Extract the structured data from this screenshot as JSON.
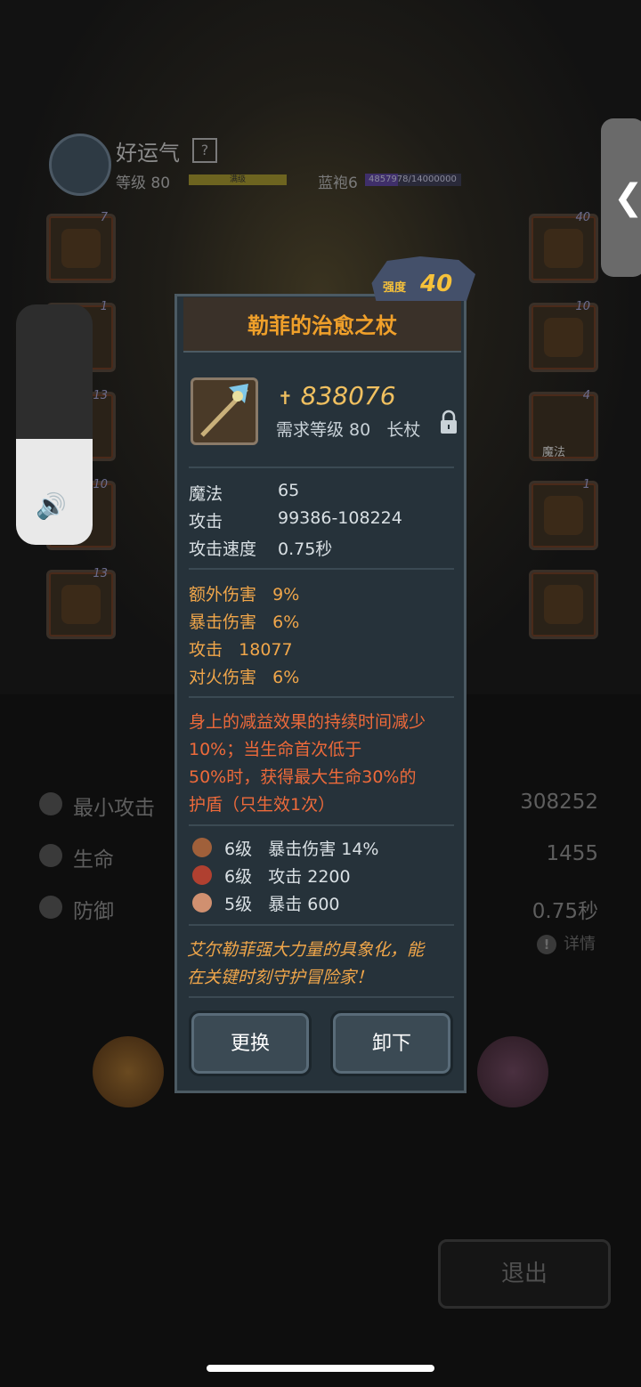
{
  "hero": {
    "name": "好运气",
    "help": "?",
    "level": "等级 80",
    "xp_label": "满级",
    "gem_label": "蓝袍6",
    "gem_progress": "4857978/14000000",
    "gem_fraction": 0.347
  },
  "slots_left": [
    {
      "num": "7"
    },
    {
      "num": "1"
    },
    {
      "num": "13"
    },
    {
      "num": "10"
    },
    {
      "num": "13"
    }
  ],
  "slots_right": [
    {
      "num": "40"
    },
    {
      "num": "10"
    },
    {
      "num": "4",
      "tag": "魔法"
    },
    {
      "num": "1"
    },
    {
      "num": ""
    }
  ],
  "volume": {
    "level": 0.44,
    "icon": "speaker-icon"
  },
  "side_handle": {
    "glyph": "❮"
  },
  "stats": [
    {
      "label": "最小攻击",
      "value": "308252",
      "icon": "sword-icon"
    },
    {
      "label": "生命",
      "value": "1455",
      "icon": "heart-icon"
    },
    {
      "label": "防御",
      "value": "0.75秒",
      "icon": "shield-icon"
    }
  ],
  "detail_label": "详情",
  "exit_label": "退出",
  "item": {
    "title": "勒菲的治愈之杖",
    "strength_label": "强度",
    "strength_value": "40",
    "power": "838076",
    "requirement": "需求等级 80",
    "type": "长杖",
    "base_stats": [
      {
        "name": "魔法",
        "value": "65"
      },
      {
        "name": "攻击",
        "value": "99386-108224"
      },
      {
        "name": "攻击速度",
        "value": "0.75秒"
      }
    ],
    "bonus_stats": [
      {
        "name": "额外伤害",
        "value": "9%"
      },
      {
        "name": "暴击伤害",
        "value": "6%"
      },
      {
        "name": "攻击",
        "value": "18077"
      },
      {
        "name": "对火伤害",
        "value": "6%"
      }
    ],
    "special_lines": [
      "身上的减益效果的持续时间减少",
      "10%；当生命首次低于",
      "50%时，获得最大生命30%的",
      "护盾（只生效1次）"
    ],
    "gems": [
      {
        "level": "6级",
        "effect": "暴击伤害 14%",
        "color": "#a0603a"
      },
      {
        "level": "6级",
        "effect": "攻击 2200",
        "color": "#b04030"
      },
      {
        "level": "5级",
        "effect": "暴击 600",
        "color": "#d09070"
      }
    ],
    "lore_lines": [
      "艾尔勒菲强大力量的具象化，能",
      "在关键时刻守护冒险家！"
    ],
    "buttons": {
      "replace": "更换",
      "unequip": "卸下"
    }
  },
  "colors": {
    "accent": "#f0a02a",
    "special": "#ee6a3a",
    "bonus": "#f0a64a",
    "panel": "#26323a"
  }
}
